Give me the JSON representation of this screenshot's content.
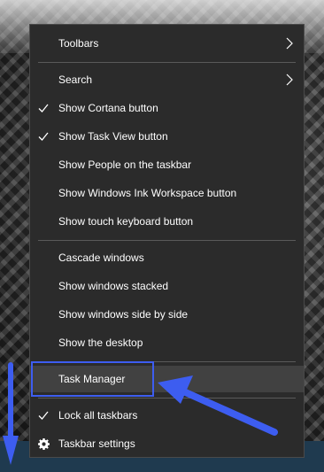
{
  "menu": {
    "items": [
      {
        "label": "Toolbars",
        "checked": false,
        "submenu": true
      },
      {
        "label": "Search",
        "checked": false,
        "submenu": true
      },
      {
        "label": "Show Cortana button",
        "checked": true
      },
      {
        "label": "Show Task View button",
        "checked": true
      },
      {
        "label": "Show People on the taskbar",
        "checked": false
      },
      {
        "label": "Show Windows Ink Workspace button",
        "checked": false
      },
      {
        "label": "Show touch keyboard button",
        "checked": false
      },
      {
        "label": "Cascade windows",
        "checked": false
      },
      {
        "label": "Show windows stacked",
        "checked": false
      },
      {
        "label": "Show windows side by side",
        "checked": false
      },
      {
        "label": "Show the desktop",
        "checked": false
      },
      {
        "label": "Task Manager",
        "checked": false,
        "highlighted": true
      },
      {
        "label": "Lock all taskbars",
        "checked": true
      },
      {
        "label": "Taskbar settings",
        "icon": "gear-icon"
      }
    ]
  },
  "annotation": {
    "arrow_color": "#3d5df0",
    "highlight_color": "#3d5df0",
    "down_arrow_color": "#3d5df0"
  },
  "colors": {
    "menu_bg": "#2b2b2b",
    "menu_hover": "#414141",
    "separator": "#5a5a5a",
    "taskbar": "#1f3a4f"
  }
}
